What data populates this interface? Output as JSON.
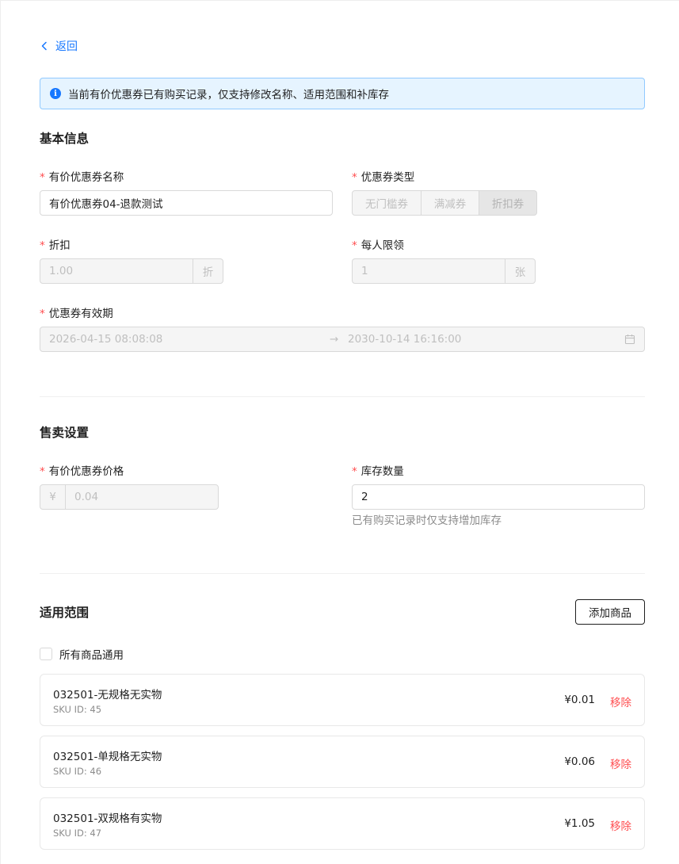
{
  "nav": {
    "back_label": "返回"
  },
  "alert": {
    "text": "当前有价优惠券已有购买记录，仅支持修改名称、适用范围和补库存"
  },
  "basic": {
    "title": "基本信息",
    "name_label": "有价优惠券名称",
    "name_value": "有价优惠券04-退款测试",
    "type_label": "优惠券类型",
    "type_options": [
      "无门槛券",
      "满减券",
      "折扣券"
    ],
    "type_selected": "折扣券",
    "discount_label": "折扣",
    "discount_value": "1.00",
    "discount_unit": "折",
    "limit_label": "每人限领",
    "limit_value": "1",
    "limit_unit": "张",
    "validity_label": "优惠券有效期",
    "validity_start": "2026-04-15 08:08:08",
    "validity_sep": "→",
    "validity_end": "2030-10-14 16:16:00"
  },
  "sale": {
    "title": "售卖设置",
    "price_label": "有价优惠券价格",
    "price_prefix": "¥",
    "price_value": "0.04",
    "stock_label": "库存数量",
    "stock_value": "2",
    "stock_help": "已有购买记录时仅支持增加库存"
  },
  "scope": {
    "title": "适用范围",
    "add_button": "添加商品",
    "all_label": "所有商品通用",
    "all_checked": false,
    "products": [
      {
        "name": "032501-无规格无实物",
        "sku": "SKU ID: 45",
        "price": "¥0.01",
        "action": "移除"
      },
      {
        "name": "032501-单规格无实物",
        "sku": "SKU ID: 46",
        "price": "¥0.06",
        "action": "移除"
      },
      {
        "name": "032501-双规格有实物",
        "sku": "SKU ID: 47",
        "price": "¥1.05",
        "action": "移除"
      }
    ]
  },
  "icons": {
    "back": "chevron-left-icon",
    "info": "info-circle-icon",
    "calendar": "calendar-icon"
  },
  "colors": {
    "primary": "#1677ff",
    "danger": "#ff4d4f",
    "alert_bg": "#e6f4ff",
    "alert_border": "#91caff"
  }
}
